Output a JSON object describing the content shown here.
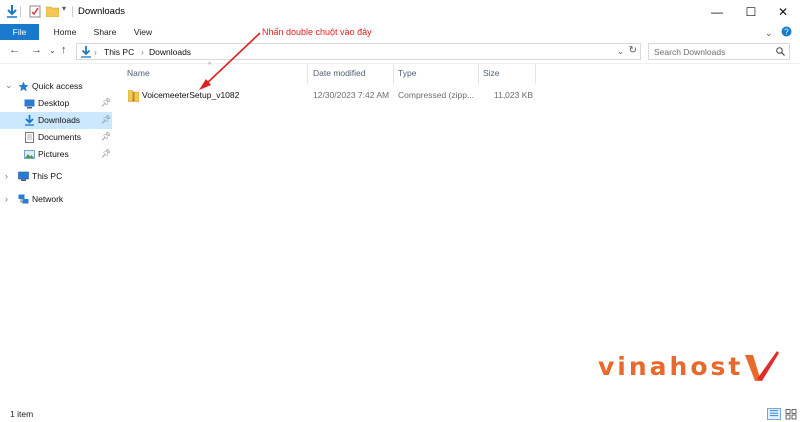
{
  "window": {
    "title": "Downloads",
    "controls": {
      "minimize": "—",
      "maximize": "☐",
      "close": "✕"
    }
  },
  "ribbon": {
    "tabs": [
      {
        "label": "File",
        "active": true
      },
      {
        "label": "Home"
      },
      {
        "label": "Share"
      },
      {
        "label": "View"
      }
    ],
    "expand_icon": "chevron-down-icon",
    "help_icon": "help-icon"
  },
  "address": {
    "crumbs": [
      "This PC",
      "Downloads"
    ],
    "search_placeholder": "Search Downloads"
  },
  "sidebar": {
    "items": [
      {
        "label": "Quick access",
        "icon": "star-icon"
      },
      {
        "label": "Desktop",
        "icon": "desktop-icon",
        "pinned": true
      },
      {
        "label": "Downloads",
        "icon": "download-icon",
        "pinned": true,
        "selected": true
      },
      {
        "label": "Documents",
        "icon": "documents-icon",
        "pinned": true
      },
      {
        "label": "Pictures",
        "icon": "pictures-icon",
        "pinned": true
      },
      {
        "label": "This PC",
        "icon": "computer-icon"
      },
      {
        "label": "Network",
        "icon": "network-icon"
      }
    ]
  },
  "files": {
    "columns": [
      "Name",
      "Date modified",
      "Type",
      "Size"
    ],
    "rows": [
      {
        "name": "VoicemeeterSetup_v1082",
        "date_modified": "12/30/2023 7:42 AM",
        "type": "Compressed (zipp...",
        "size": "11,023 KB",
        "icon": "zip-folder-icon"
      }
    ]
  },
  "annotation": {
    "text": "Nhấn double chuột vào đây",
    "color": "#e02020"
  },
  "status": {
    "item_count": "1 item"
  },
  "watermark": {
    "text": "vinahost",
    "color": "#e8692b"
  },
  "colors": {
    "accent": "#1979ca",
    "selected": "#cce8ff"
  }
}
